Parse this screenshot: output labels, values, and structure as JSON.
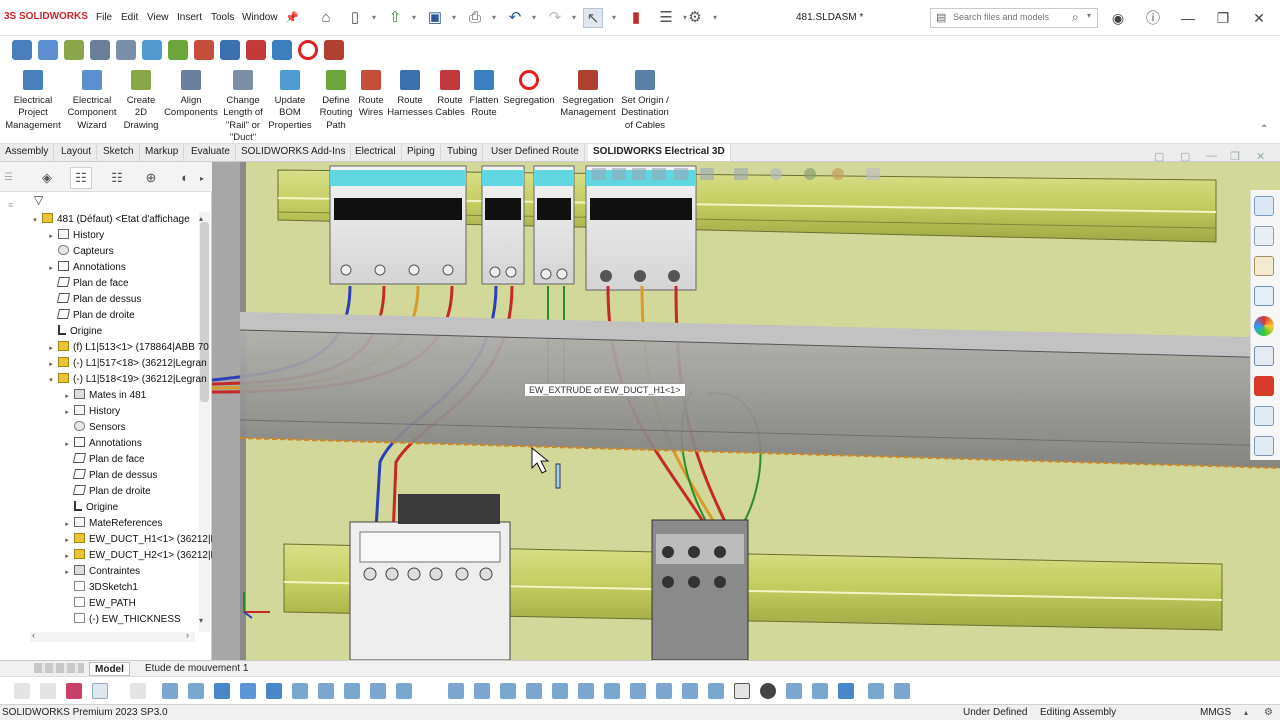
{
  "app": {
    "brand_prefix": "3S",
    "brand_name": "SOLIDWORKS",
    "document_title": "481.SLDASM *"
  },
  "menu": [
    "File",
    "Edit",
    "View",
    "Insert",
    "Tools",
    "Window"
  ],
  "search": {
    "placeholder": "Search files and models"
  },
  "ribbon": [
    {
      "label": "Electrical\nProject\nManagement",
      "icon": "project-management-icon",
      "color": "#4a7fbf"
    },
    {
      "label": "Electrical\nComponent\nWizard",
      "icon": "component-wizard-icon",
      "color": "#5b8fcf"
    },
    {
      "label": "Create\n2D\nDrawing",
      "icon": "drawing-icon",
      "color": "#8aa84a"
    },
    {
      "label": "Align\nComponents",
      "icon": "align-icon",
      "color": "#6a7f9a"
    },
    {
      "label": "Change\nLength of\n\"Rail\" or\n\"Duct\"",
      "icon": "length-icon",
      "color": "#7b8fa8"
    },
    {
      "label": "Update\nBOM\nProperties",
      "icon": "bom-icon",
      "color": "#4f9ad0"
    },
    {
      "label": "Define\nRouting\nPath",
      "icon": "routing-path-icon",
      "color": "#6aa63a"
    },
    {
      "label": "Route\nWires",
      "icon": "route-wires-icon",
      "color": "#c64c3c"
    },
    {
      "label": "Route\nHarnesses",
      "icon": "harness-icon",
      "color": "#3a70b0"
    },
    {
      "label": "Route\nCables",
      "icon": "cables-icon",
      "color": "#c23a3a"
    },
    {
      "label": "Flatten\nRoute",
      "icon": "flatten-icon",
      "color": "#3a7fc0"
    },
    {
      "label": "Segregation",
      "icon": "segregation-icon",
      "color": "#e02020"
    },
    {
      "label": "Segregation\nManagement",
      "icon": "segregation-management-icon",
      "color": "#b04030"
    },
    {
      "label": "Set Origin /\nDestination\nof Cables",
      "icon": "origin-destination-icon",
      "color": "#5a7fa8"
    }
  ],
  "tabs": [
    {
      "label": "Assembly",
      "active": false
    },
    {
      "label": "Layout",
      "active": false
    },
    {
      "label": "Sketch",
      "active": false
    },
    {
      "label": "Markup",
      "active": false
    },
    {
      "label": "Evaluate",
      "active": false
    },
    {
      "label": "SOLIDWORKS Add-Ins",
      "active": false
    },
    {
      "label": "Electrical",
      "active": false
    },
    {
      "label": "Piping",
      "active": false
    },
    {
      "label": "Tubing",
      "active": false
    },
    {
      "label": "User Defined Route",
      "active": false
    },
    {
      "label": "SOLIDWORKS Electrical 3D",
      "active": true
    }
  ],
  "tree": [
    {
      "label": "481 (Défaut) <Etat d'affichage",
      "indent": 0,
      "icon": "part",
      "expander": "collapse"
    },
    {
      "label": "History",
      "indent": 1,
      "icon": "folder",
      "expander": "expand"
    },
    {
      "label": "Capteurs",
      "indent": 1,
      "icon": "sensor",
      "expander": ""
    },
    {
      "label": "Annotations",
      "indent": 1,
      "icon": "annot",
      "expander": "expand"
    },
    {
      "label": "Plan de face",
      "indent": 1,
      "icon": "plane",
      "expander": ""
    },
    {
      "label": "Plan de dessus",
      "indent": 1,
      "icon": "plane",
      "expander": ""
    },
    {
      "label": "Plan de droite",
      "indent": 1,
      "icon": "plane",
      "expander": ""
    },
    {
      "label": "Origine",
      "indent": 1,
      "icon": "origin",
      "expander": ""
    },
    {
      "label": "(f) L1|513<1> (178864|ABB 70",
      "indent": 1,
      "icon": "part",
      "expander": "expand"
    },
    {
      "label": "(-) L1|517<18> (36212|Legran",
      "indent": 1,
      "icon": "part",
      "expander": "expand"
    },
    {
      "label": "(-) L1|518<19> (36212|Legran",
      "indent": 1,
      "icon": "part",
      "expander": "collapse"
    },
    {
      "label": "Mates in 481",
      "indent": 2,
      "icon": "mates",
      "expander": "expand"
    },
    {
      "label": "History",
      "indent": 2,
      "icon": "folder",
      "expander": "expand"
    },
    {
      "label": "Sensors",
      "indent": 2,
      "icon": "sensor",
      "expander": ""
    },
    {
      "label": "Annotations",
      "indent": 2,
      "icon": "annot",
      "expander": "expand"
    },
    {
      "label": "Plan de face",
      "indent": 2,
      "icon": "plane",
      "expander": ""
    },
    {
      "label": "Plan de dessus",
      "indent": 2,
      "icon": "plane",
      "expander": ""
    },
    {
      "label": "Plan de droite",
      "indent": 2,
      "icon": "plane",
      "expander": ""
    },
    {
      "label": "Origine",
      "indent": 2,
      "icon": "origin",
      "expander": ""
    },
    {
      "label": "MateReferences",
      "indent": 2,
      "icon": "folder",
      "expander": "expand"
    },
    {
      "label": "EW_DUCT_H1<1> (36212|L",
      "indent": 2,
      "icon": "part",
      "expander": "expand"
    },
    {
      "label": "EW_DUCT_H2<1> (36212|L",
      "indent": 2,
      "icon": "part",
      "expander": "expand"
    },
    {
      "label": "Contraintes",
      "indent": 2,
      "icon": "mates",
      "expander": "expand"
    },
    {
      "label": "3DSketch1",
      "indent": 2,
      "icon": "sketch",
      "expander": ""
    },
    {
      "label": "EW_PATH",
      "indent": 2,
      "icon": "sketch",
      "expander": ""
    },
    {
      "label": "(-) EW_THICKNESS",
      "indent": 2,
      "icon": "sketch",
      "expander": ""
    }
  ],
  "viewport": {
    "tooltip": "EW_EXTRUDE of EW_DUCT_H1<1>"
  },
  "bottom_tabs": [
    {
      "label": "Model",
      "active": true
    },
    {
      "label": "Etude de mouvement 1",
      "active": false
    }
  ],
  "status": {
    "product": "SOLIDWORKS Premium 2023 SP3.0",
    "definition": "Under Defined",
    "mode": "Editing Assembly",
    "units": "MMGS"
  },
  "colors": {
    "background_3d": "#d2d79a",
    "duct": "#a9a9a9",
    "rail": "#c8d16a",
    "wire_blue": "#2a3fb8",
    "wire_red": "#c42828",
    "wire_orange": "#d89a2a",
    "wire_green": "#2c8a2c"
  }
}
